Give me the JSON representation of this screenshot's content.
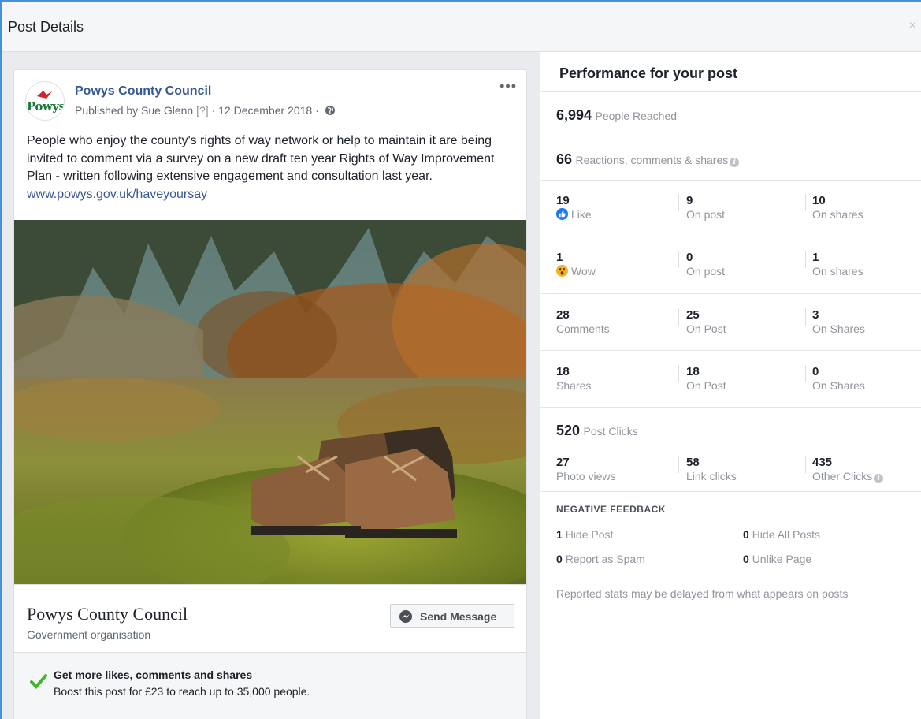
{
  "dialog": {
    "title": "Post Details",
    "close_glyph": "×"
  },
  "post": {
    "page_name": "Powys County Council",
    "avatar_logo_text": "Powys",
    "published_by": "Published by Sue Glenn",
    "help_marker": "[?]",
    "date": "· 12 December 2018 ·",
    "more_glyph": "•••",
    "text": "People who enjoy the county's rights of way network or help to maintain it are being invited to comment via a survey on a new draft ten year Rights of Way Improvement Plan - written following extensive engagement and consultation last year.",
    "link": "www.powys.gov.uk/haveyoursay",
    "photo_icon": "walking-boots-on-moss-photo"
  },
  "page_footer": {
    "name": "Powys County Council",
    "category": "Government organisation",
    "send_message": "Send Message"
  },
  "boost": {
    "title": "Get more likes, comments and shares",
    "description": "Boost this post for £23 to reach up to 35,000 people."
  },
  "performance": {
    "title": "Performance for your post",
    "reached": {
      "value": "6,994",
      "label": "People Reached"
    },
    "engagement": {
      "value": "66",
      "label": "Reactions, comments & shares"
    },
    "rows": [
      {
        "cells": [
          {
            "num": "19",
            "label": "Like"
          },
          {
            "num": "9",
            "label": "On post"
          },
          {
            "num": "10",
            "label": "On shares"
          }
        ]
      },
      {
        "cells": [
          {
            "num": "1",
            "label": "Wow"
          },
          {
            "num": "0",
            "label": "On post"
          },
          {
            "num": "1",
            "label": "On shares"
          }
        ]
      },
      {
        "cells": [
          {
            "num": "28",
            "label": "Comments"
          },
          {
            "num": "25",
            "label": "On Post"
          },
          {
            "num": "3",
            "label": "On Shares"
          }
        ]
      },
      {
        "cells": [
          {
            "num": "18",
            "label": "Shares"
          },
          {
            "num": "18",
            "label": "On Post"
          },
          {
            "num": "0",
            "label": "On Shares"
          }
        ]
      }
    ],
    "clicks": {
      "value": "520",
      "label": "Post Clicks",
      "cells": [
        {
          "num": "27",
          "label": "Photo views"
        },
        {
          "num": "58",
          "label": "Link clicks"
        },
        {
          "num": "435",
          "label": "Other Clicks"
        }
      ]
    },
    "negative": {
      "heading": "NEGATIVE FEEDBACK",
      "items": [
        {
          "num": "1",
          "label": "Hide Post"
        },
        {
          "num": "0",
          "label": "Hide All Posts"
        },
        {
          "num": "0",
          "label": "Report as Spam"
        },
        {
          "num": "0",
          "label": "Unlike Page"
        }
      ]
    },
    "note": "Reported stats may be delayed from what appears on posts"
  },
  "colors": {
    "link": "#365899",
    "frame_accent": "#4a90d9",
    "like_blue": "#1877f2",
    "wow_yellow": "#f7b125",
    "check_green": "#42b72a"
  }
}
